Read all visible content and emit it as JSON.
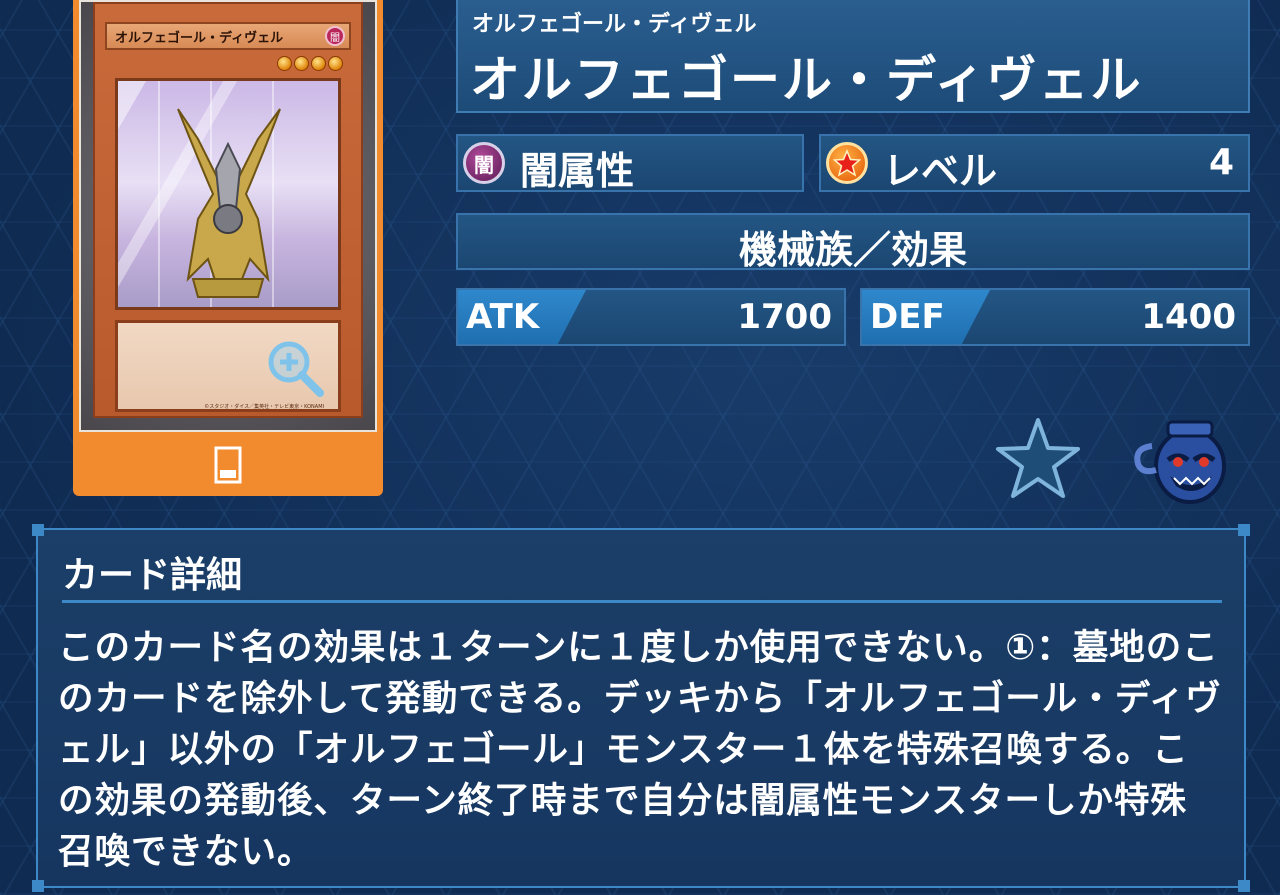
{
  "card_image": {
    "card_name": "オルフェゴール・ディヴェル",
    "attribute_glyph": "闇",
    "stars": 4,
    "copyright": "©スタジオ・ダイス／集英社・テレビ東京・KONAMI"
  },
  "card": {
    "ruby": "オルフェゴール・ディヴェル",
    "name": "オルフェゴール・ディヴェル",
    "attribute_glyph": "闇",
    "attribute_label": "闇属性",
    "level_label": "レベル",
    "level_value": "4",
    "race": "機械族／効果",
    "atk_label": "ATK",
    "atk_value": "1700",
    "def_label": "DEF",
    "def_value": "1400"
  },
  "detail": {
    "title": "カード詳細",
    "text": "このカード名の効果は１ターンに１度しか使用できない。①：墓地のこのカードを除外して発動できる。デッキから「オルフェゴール・ディヴェル」以外の「オルフェゴール」モンスター１体を特殊召喚する。この効果の発動後、ターン終了時まで自分は闇属性モンスターしか特殊召喚できない。"
  },
  "colors": {
    "card_frame": "#f28a2e",
    "panel": "#1d4b78",
    "border": "#3d88c7",
    "stat_tag": "#2f88cc"
  },
  "icons": {
    "zoom": "zoom-in-icon",
    "card_type": "card-icon",
    "favorite": "star-icon",
    "deck_pot": "pot-icon"
  }
}
